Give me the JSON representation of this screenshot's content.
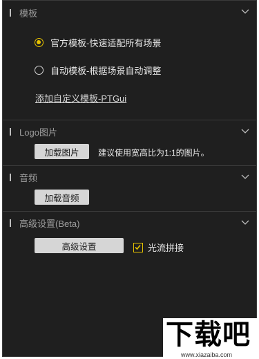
{
  "colors": {
    "accent": "#e6c200",
    "panel_bg": "#1f1f1f",
    "button_bg": "#d6d6d6"
  },
  "sections": {
    "template": {
      "title": "模板",
      "options": [
        {
          "label": "官方模板-快速适配所有场景",
          "checked": true
        },
        {
          "label": "自动模板-根据场景自动调整",
          "checked": false
        }
      ],
      "custom_link": "添加自定义模板-PTGui"
    },
    "logo": {
      "title": "Logo图片",
      "load_button": "加载图片",
      "hint": "建议使用宽高比为1:1的图片。"
    },
    "audio": {
      "title": "音频",
      "load_button": "加载音频"
    },
    "advanced": {
      "title": "高级设置(Beta)",
      "settings_button": "高级设置",
      "optical_flow_label": "光流拼接",
      "optical_flow_checked": true
    }
  },
  "watermark": {
    "main": "下载吧",
    "sub": "www.xiazaiba.com"
  },
  "icons": {
    "collapse": "chevron-down-icon",
    "check": "checkmark-icon"
  }
}
